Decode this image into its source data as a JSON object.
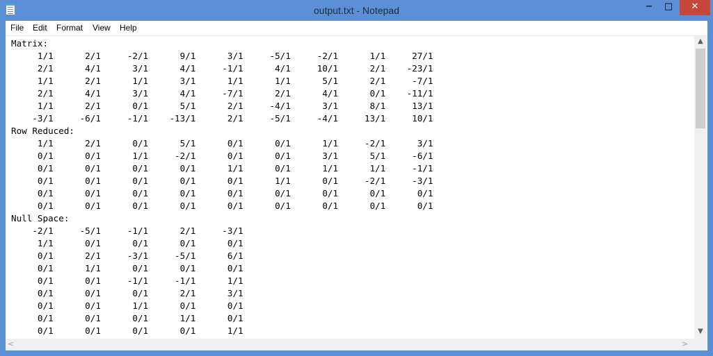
{
  "window": {
    "title": "output.txt - Notepad",
    "controls": {
      "minimize": "−",
      "maximize": "□",
      "close": "✕"
    }
  },
  "menu": [
    "File",
    "Edit",
    "Format",
    "View",
    "Help"
  ],
  "scrollbar": {
    "up": "▲",
    "down": "▼",
    "left": "<",
    "right": ">"
  },
  "document_lines": [
    "Matrix:",
    "     1/1      2/1     -2/1      9/1      3/1     -5/1     -2/1      1/1     27/1",
    "     2/1      4/1      3/1      4/1     -1/1      4/1     10/1      2/1    -23/1",
    "     1/1      2/1      1/1      3/1      1/1      1/1      5/1      2/1     -7/1",
    "     2/1      4/1      3/1      4/1     -7/1      2/1      4/1      0/1    -11/1",
    "     1/1      2/1      0/1      5/1      2/1     -4/1      3/1      8/1     13/1",
    "    -3/1     -6/1     -1/1    -13/1      2/1     -5/1     -4/1     13/1     10/1",
    "Row Reduced:",
    "     1/1      2/1      0/1      5/1      0/1      0/1      1/1     -2/1      3/1",
    "     0/1      0/1      1/1     -2/1      0/1      0/1      3/1      5/1     -6/1",
    "     0/1      0/1      0/1      0/1      1/1      0/1      1/1      1/1     -1/1",
    "     0/1      0/1      0/1      0/1      0/1      1/1      0/1     -2/1     -3/1",
    "     0/1      0/1      0/1      0/1      0/1      0/1      0/1      0/1      0/1",
    "     0/1      0/1      0/1      0/1      0/1      0/1      0/1      0/1      0/1",
    "Null Space:",
    "    -2/1     -5/1     -1/1      2/1     -3/1",
    "     1/1      0/1      0/1      0/1      0/1",
    "     0/1      2/1     -3/1     -5/1      6/1",
    "     0/1      1/1      0/1      0/1      0/1",
    "     0/1      0/1     -1/1     -1/1      1/1",
    "     0/1      0/1      0/1      2/1      3/1",
    "     0/1      0/1      1/1      0/1      0/1",
    "     0/1      0/1      0/1      1/1      0/1",
    "     0/1      0/1      0/1      0/1      1/1"
  ]
}
